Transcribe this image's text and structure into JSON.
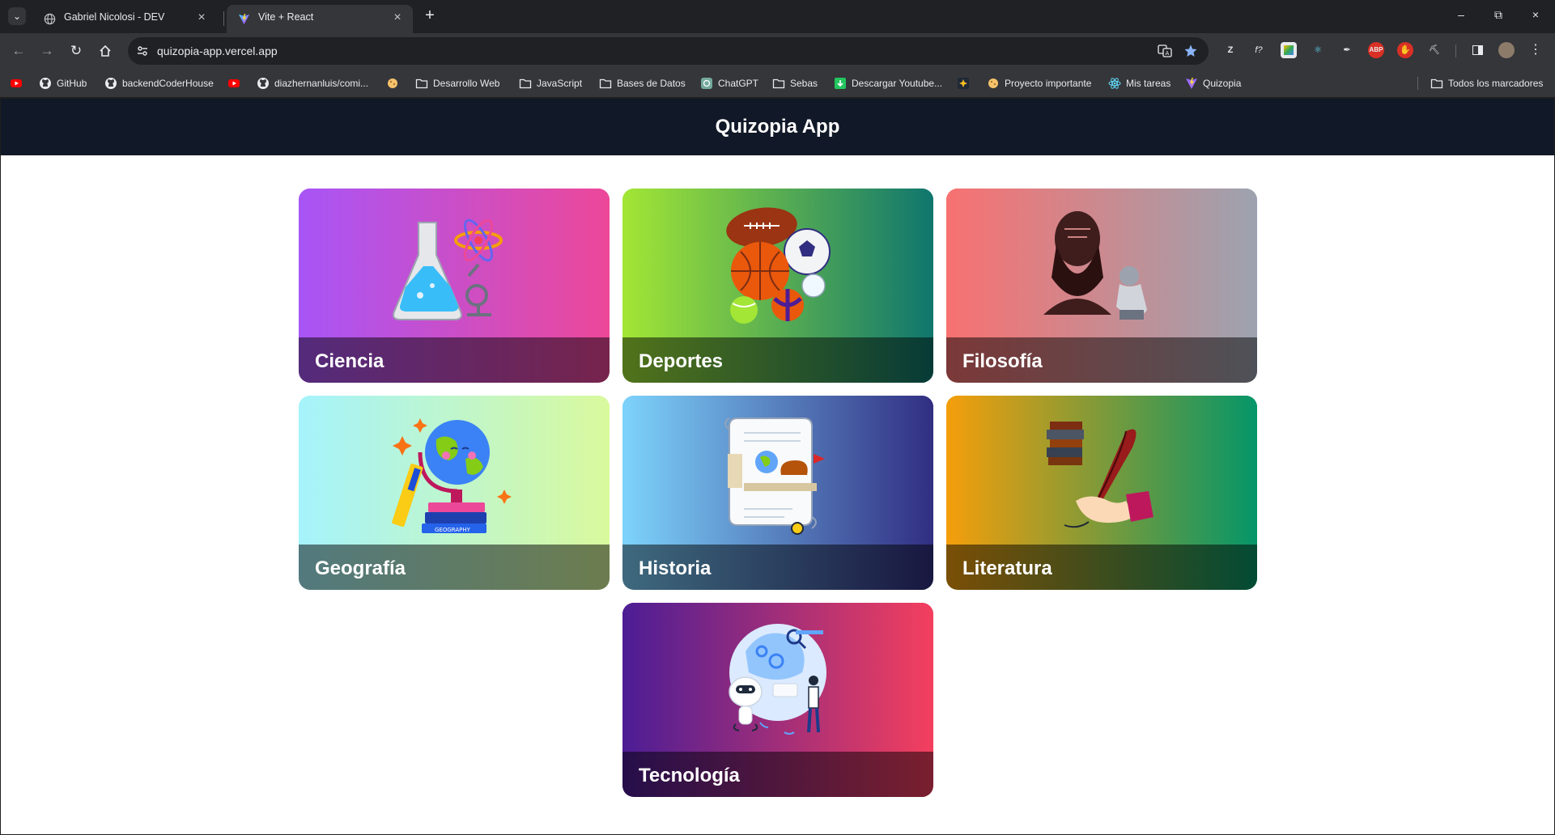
{
  "browser": {
    "tabs": [
      {
        "title": "Gabriel Nicolosi - DEV",
        "icon": "globe-icon",
        "active": false
      },
      {
        "title": "Vite + React",
        "icon": "vite-icon",
        "active": true
      }
    ],
    "url": "quizopia-app.vercel.app",
    "bookmarks": [
      {
        "label": "",
        "icon": "youtube-icon"
      },
      {
        "label": "GitHub",
        "icon": "github-icon"
      },
      {
        "label": "backendCoderHouse",
        "icon": "github-icon"
      },
      {
        "label": "",
        "icon": "youtube-icon"
      },
      {
        "label": "diazhernanluis/comi...",
        "icon": "github-icon"
      },
      {
        "label": "",
        "icon": "cookie-icon"
      },
      {
        "label": "Desarrollo Web",
        "icon": "folder-icon"
      },
      {
        "label": "JavaScript",
        "icon": "folder-icon"
      },
      {
        "label": "Bases de Datos",
        "icon": "folder-icon"
      },
      {
        "label": "ChatGPT",
        "icon": "chatgpt-icon"
      },
      {
        "label": "Sebas",
        "icon": "folder-icon"
      },
      {
        "label": "Descargar Youtube...",
        "icon": "download-icon"
      },
      {
        "label": "",
        "icon": "sparkle-icon"
      },
      {
        "label": "Proyecto importante",
        "icon": "cookie-icon"
      },
      {
        "label": "Mis tareas",
        "icon": "react-icon"
      },
      {
        "label": "Quizopia",
        "icon": "vite-icon"
      }
    ],
    "all_bookmarks_label": "Todos los marcadores"
  },
  "app": {
    "title": "Quizopia App",
    "categories": [
      {
        "label": "Ciencia",
        "icon": "science-icon",
        "gradient": [
          "#a855f7",
          "#ec4899"
        ]
      },
      {
        "label": "Deportes",
        "icon": "sports-balls-icon",
        "gradient": [
          "#a3e635",
          "#0f766e"
        ]
      },
      {
        "label": "Filosofía",
        "icon": "philosopher-bust-icon",
        "gradient": [
          "#f87171",
          "#9ca3af"
        ]
      },
      {
        "label": "Geografía",
        "icon": "globe-books-icon",
        "gradient": [
          "#a5f3fc",
          "#d9f99d"
        ]
      },
      {
        "label": "Historia",
        "icon": "scroll-icon",
        "gradient": [
          "#7dd3fc",
          "#312e81"
        ]
      },
      {
        "label": "Literatura",
        "icon": "quill-books-icon",
        "gradient": [
          "#f59e0b",
          "#059669"
        ]
      },
      {
        "label": "Tecnología",
        "icon": "tech-robot-icon",
        "gradient": [
          "#4c1d95",
          "#f43f5e"
        ]
      }
    ]
  }
}
